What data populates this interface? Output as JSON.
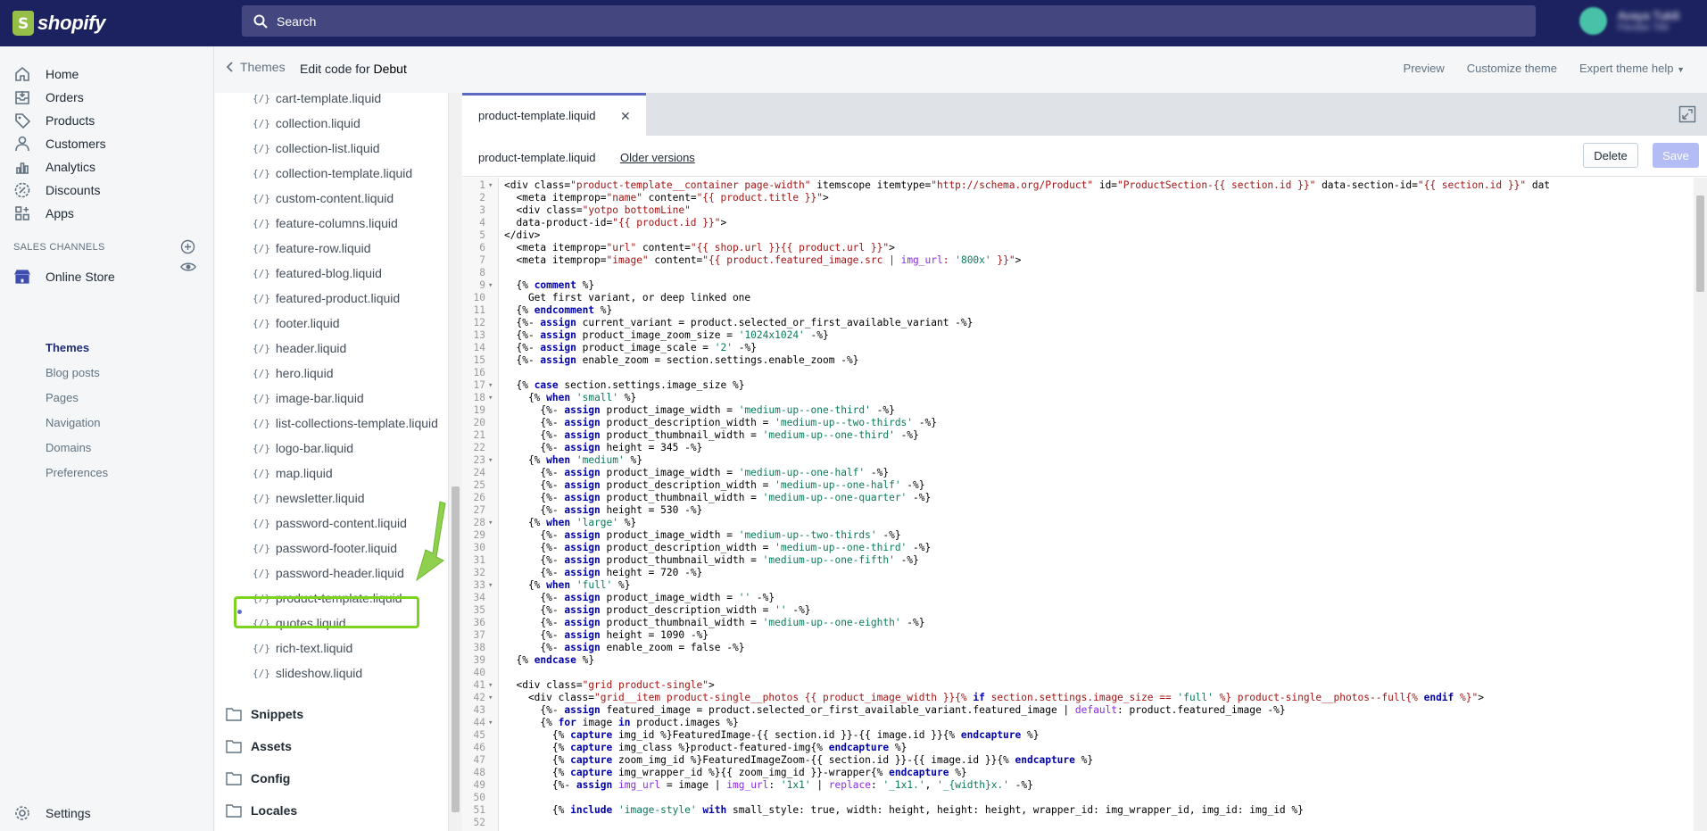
{
  "topbar": {
    "brand": "shopify",
    "search_placeholder": "Search",
    "account_name": "Avaya Tukili",
    "account_store": "Flexibe 789"
  },
  "nav": {
    "items": [
      {
        "label": "Home",
        "icon": "home-icon"
      },
      {
        "label": "Orders",
        "icon": "orders-icon"
      },
      {
        "label": "Products",
        "icon": "tag-icon"
      },
      {
        "label": "Customers",
        "icon": "person-icon"
      },
      {
        "label": "Analytics",
        "icon": "chart-icon"
      },
      {
        "label": "Discounts",
        "icon": "discount-icon"
      },
      {
        "label": "Apps",
        "icon": "apps-icon"
      }
    ],
    "sales_channels_heading": "SALES CHANNELS",
    "online_store": "Online Store",
    "sub_items": [
      "Themes",
      "Blog posts",
      "Pages",
      "Navigation",
      "Domains",
      "Preferences"
    ],
    "settings": "Settings"
  },
  "header": {
    "back_label": "Themes",
    "title_prefix": "Edit code for",
    "theme_name": "Debut",
    "actions": [
      "Preview",
      "Customize theme",
      "Expert theme help"
    ]
  },
  "files": {
    "section_files": [
      "cart-template.liquid",
      "collection.liquid",
      "collection-list.liquid",
      "collection-template.liquid",
      "custom-content.liquid",
      "feature-columns.liquid",
      "feature-row.liquid",
      "featured-blog.liquid",
      "featured-product.liquid",
      "footer.liquid",
      "header.liquid",
      "hero.liquid",
      "image-bar.liquid",
      "list-collections-template.liquid",
      "logo-bar.liquid",
      "map.liquid",
      "newsletter.liquid",
      "password-content.liquid",
      "password-footer.liquid",
      "password-header.liquid",
      "product-template.liquid",
      "quotes.liquid",
      "rich-text.liquid",
      "slideshow.liquid"
    ],
    "selected": "product-template.liquid",
    "folders": [
      "Snippets",
      "Assets",
      "Config",
      "Locales"
    ]
  },
  "editor": {
    "tab_label": "product-template.liquid",
    "file_name": "product-template.liquid",
    "older_versions": "Older versions",
    "delete_label": "Delete",
    "save_label": "Save",
    "lines": [
      "<div class=\"product-template__container page-width\" itemscope itemtype=\"http://schema.org/Product\" id=\"ProductSection-{{ section.id }}\" data-section-id=\"{{ section.id }}\" dat",
      "  <meta itemprop=\"name\" content=\"{{ product.title }}\">",
      "  <div class=\"yotpo bottomLine\"",
      "  data-product-id=\"{{ product.id }}\">",
      "</div>",
      "  <meta itemprop=\"url\" content=\"{{ shop.url }}{{ product.url }}\">",
      "  <meta itemprop=\"image\" content=\"{{ product.featured_image.src | img_url: '800x' }}\">",
      "",
      "  {% comment %}",
      "    Get first variant, or deep linked one",
      "  {% endcomment %}",
      "  {%- assign current_variant = product.selected_or_first_available_variant -%}",
      "  {%- assign product_image_zoom_size = '1024x1024' -%}",
      "  {%- assign product_image_scale = '2' -%}",
      "  {%- assign enable_zoom = section.settings.enable_zoom -%}",
      "",
      "  {% case section.settings.image_size %}",
      "    {% when 'small' %}",
      "      {%- assign product_image_width = 'medium-up--one-third' -%}",
      "      {%- assign product_description_width = 'medium-up--two-thirds' -%}",
      "      {%- assign product_thumbnail_width = 'medium-up--one-third' -%}",
      "      {%- assign height = 345 -%}",
      "    {% when 'medium' %}",
      "      {%- assign product_image_width = 'medium-up--one-half' -%}",
      "      {%- assign product_description_width = 'medium-up--one-half' -%}",
      "      {%- assign product_thumbnail_width = 'medium-up--one-quarter' -%}",
      "      {%- assign height = 530 -%}",
      "    {% when 'large' %}",
      "      {%- assign product_image_width = 'medium-up--two-thirds' -%}",
      "      {%- assign product_description_width = 'medium-up--one-third' -%}",
      "      {%- assign product_thumbnail_width = 'medium-up--one-fifth' -%}",
      "      {%- assign height = 720 -%}",
      "    {% when 'full' %}",
      "      {%- assign product_image_width = '' -%}",
      "      {%- assign product_description_width = '' -%}",
      "      {%- assign product_thumbnail_width = 'medium-up--one-eighth' -%}",
      "      {%- assign height = 1090 -%}",
      "      {%- assign enable_zoom = false -%}",
      "  {% endcase %}",
      "",
      "  <div class=\"grid product-single\">",
      "    <div class=\"grid__item product-single__photos {{ product_image_width }}{% if section.settings.image_size == 'full' %} product-single__photos--full{% endif %}\">",
      "      {%- assign featured_image = product.selected_or_first_available_variant.featured_image | default: product.featured_image -%}",
      "      {% for image in product.images %}",
      "        {% capture img_id %}FeaturedImage-{{ section.id }}-{{ image.id }}{% endcapture %}",
      "        {% capture img_class %}product-featured-img{% endcapture %}",
      "        {% capture zoom_img_id %}FeaturedImageZoom-{{ section.id }}-{{ image.id }}{% endcapture %}",
      "        {% capture img_wrapper_id %}{{ zoom_img_id }}-wrapper{% endcapture %}",
      "        {%- assign img_url = image | img_url: '1x1' | replace: '_1x1.', '_{width}x.' -%}",
      "",
      "        {% include 'image-style' with small_style: true, width: height, height: height, wrapper_id: img_wrapper_id, img_id: img_id %}",
      ""
    ],
    "fold_lines": [
      1,
      9,
      17,
      18,
      23,
      28,
      33,
      41,
      42,
      44
    ]
  }
}
